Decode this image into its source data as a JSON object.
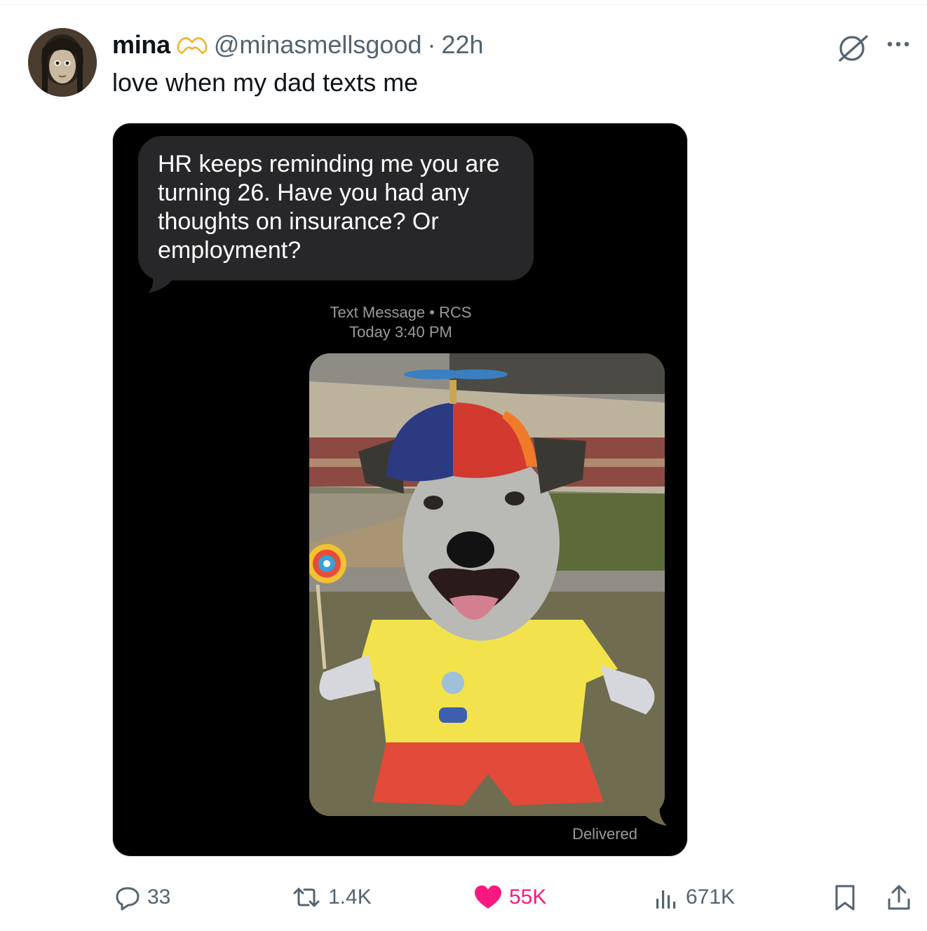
{
  "tweet": {
    "display_name": "mina",
    "badge_icon": "heart-hands-icon",
    "handle": "@minasmellsgood",
    "separator": "·",
    "time": "22h",
    "text": "love when my dad texts me"
  },
  "message_screenshot": {
    "incoming_text": "HR keeps reminding me you are\nturning 26.  Have you had any\nthoughts on insurance?  Or\nemployment?",
    "meta_line_1": "Text Message • RCS",
    "meta_line_2": "Today 3:40 PM",
    "image_description_icon": "dog-in-propeller-hat-image",
    "status": "Delivered"
  },
  "actions": {
    "replies": "33",
    "reposts": "1.4K",
    "likes": "55K",
    "views": "671K"
  },
  "colors": {
    "like_pink": "#f91880",
    "muted_gray": "#536471",
    "bubble_gray": "#272729"
  }
}
